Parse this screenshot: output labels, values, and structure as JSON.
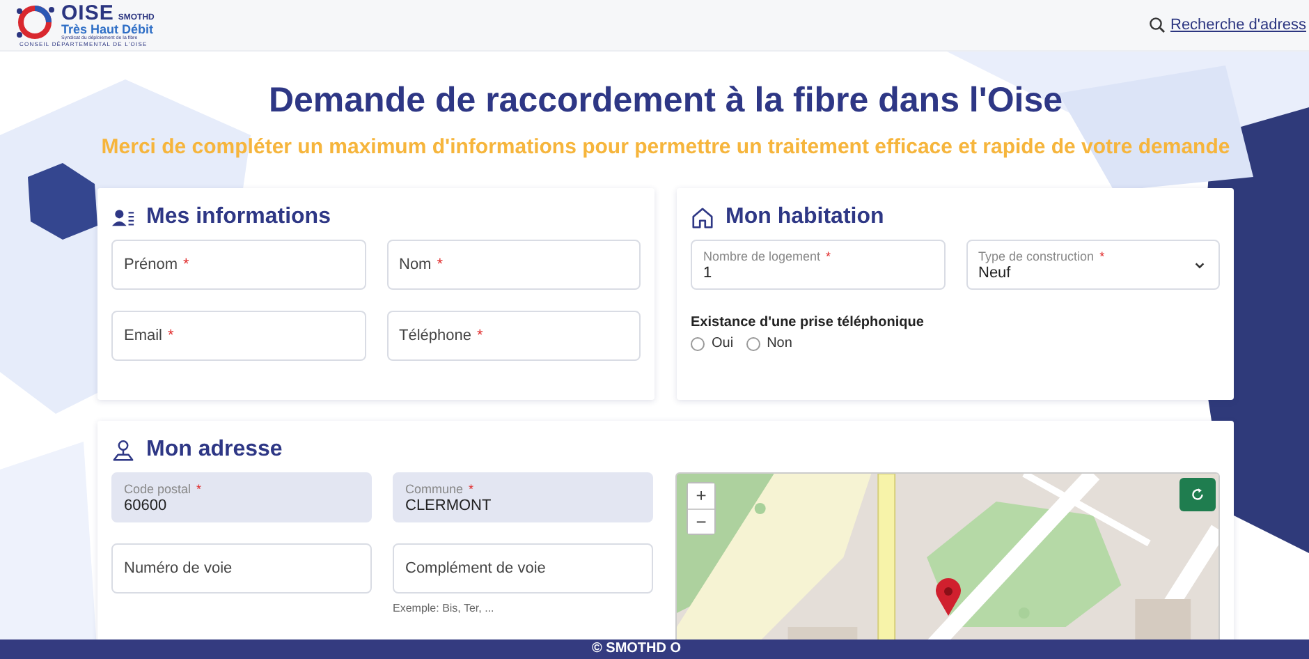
{
  "header": {
    "logo": {
      "name": "OISE",
      "badge": "SMOTHD",
      "tagline": "Très Haut Débit",
      "subline": "Syndicat du déploiement de la fibre",
      "footer": "CONSEIL DÉPARTEMENTAL DE L'OISE"
    },
    "search_link": "Recherche d'adress"
  },
  "title": "Demande de raccordement à la fibre dans l'Oise",
  "subtitle": "Merci de compléter un maximum d'informations pour permettre un traitement efficace et rapide de votre demande",
  "info": {
    "title": "Mes informations",
    "fields": [
      {
        "label": "Prénom",
        "required_mark": "*",
        "kind": "text",
        "disabled": false
      },
      {
        "label": "Nom",
        "required_mark": "*",
        "kind": "text",
        "disabled": false
      },
      {
        "label": "Email",
        "required_mark": "*",
        "kind": "text",
        "disabled": false
      },
      {
        "label": "Téléphone",
        "required_mark": "*",
        "kind": "text",
        "disabled": false
      }
    ]
  },
  "habitation": {
    "title": "Mon habitation",
    "fields": [
      {
        "label": "Nombre de logement",
        "required_mark": "*",
        "kind": "text",
        "disabled": false,
        "value": "1"
      },
      {
        "label": "Type de construction",
        "required_mark": "*",
        "kind": "select",
        "disabled": false,
        "value": "Neuf"
      }
    ],
    "radio_group": {
      "label": "Existance d'une prise téléphonique",
      "options": [
        {
          "label": "Oui",
          "selected": false
        },
        {
          "label": "Non",
          "selected": false
        }
      ]
    }
  },
  "address": {
    "title": "Mon adresse",
    "fields": [
      {
        "label": "Code postal",
        "required_mark": "*",
        "kind": "text",
        "disabled": true,
        "value": "60600"
      },
      {
        "label": "Commune",
        "required_mark": "*",
        "kind": "text",
        "disabled": true,
        "value": "CLERMONT"
      },
      {
        "label": "Numéro de voie",
        "kind": "text",
        "disabled": false
      },
      {
        "label": "Complément de voie",
        "kind": "text",
        "disabled": false,
        "helper": "Exemple: Bis, Ter, ..."
      }
    ],
    "map": {
      "kind": "picture",
      "zoom_in": "+",
      "zoom_out": "−"
    }
  },
  "footer": "© SMOTHD O"
}
